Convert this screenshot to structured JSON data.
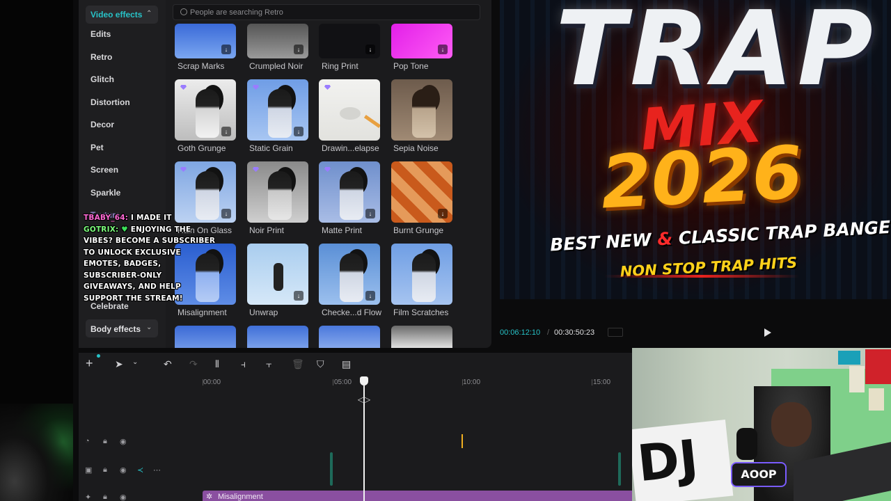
{
  "effects_panel": {
    "active_category": "Video effects",
    "categories": [
      "Edits",
      "Retro",
      "Glitch",
      "Distortion",
      "Decor",
      "Pet",
      "Screen",
      "Sparkle",
      "Texture",
      "Celebrate"
    ],
    "body_effects_label": "Body effects",
    "search_placeholder": "People are searching Retro",
    "effects": [
      {
        "name": "Scrap Marks"
      },
      {
        "name": "Crumpled Noir"
      },
      {
        "name": "Ring Print"
      },
      {
        "name": "Pop Tone"
      },
      {
        "name": "Goth Grunge"
      },
      {
        "name": "Static Grain"
      },
      {
        "name": "Drawin...elapse"
      },
      {
        "name": "Sepia Noise"
      },
      {
        "name": "Rain On Glass"
      },
      {
        "name": "Noir Print"
      },
      {
        "name": "Matte Print"
      },
      {
        "name": "Burnt Grunge"
      },
      {
        "name": "Misalignment"
      },
      {
        "name": "Unwrap"
      },
      {
        "name": "Checke...d Flow"
      },
      {
        "name": "Film Scratches"
      }
    ]
  },
  "chat": {
    "messages": [
      {
        "user": "TBABY_64:",
        "text": "I MADE IT"
      },
      {
        "user": "GOTRIX:",
        "text": "ENJOYING THE VIBES? BECOME A SUBSCRIBER TO UNLOCK EXCLUSIVE EMOTES, BADGES, SUBSCRIBER-ONLY GIVEAWAYS, AND HELP SUPPORT THE STREAM!"
      }
    ]
  },
  "preview": {
    "title_word": "TRAP",
    "mix_word": "MIX",
    "year": "2026",
    "line1_a": "BEST NEW",
    "line1_amp": "&",
    "line1_b": "CLASSIC TRAP BANGERS",
    "line2": "NON STOP TRAP HITS",
    "current_time": "00:06:12:10",
    "separator": "/",
    "total_time": "00:30:50:23"
  },
  "timeline": {
    "ruler_labels": [
      "00:00",
      "05:00",
      "10:00",
      "15:00"
    ],
    "clip_label": "Misalignment"
  },
  "webcam": {
    "sign_text": "DJ",
    "mic_sign_text": "AOOP"
  },
  "colors": {
    "accent": "#27c3c8",
    "clip": "#8a4fa0",
    "panel": "#1b1b1d"
  }
}
